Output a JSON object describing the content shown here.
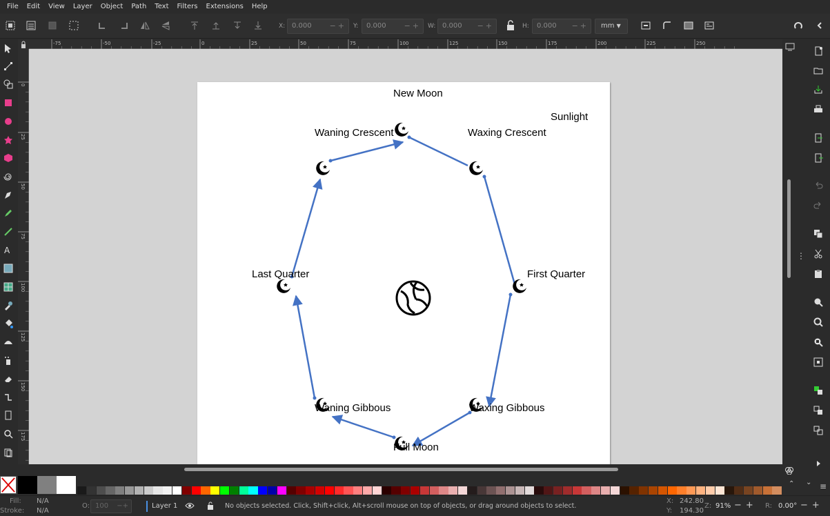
{
  "menu": [
    "File",
    "Edit",
    "View",
    "Layer",
    "Object",
    "Path",
    "Text",
    "Filters",
    "Extensions",
    "Help"
  ],
  "toolbar": {
    "x_label": "X:",
    "x_value": "0.000",
    "y_label": "Y:",
    "y_value": "0.000",
    "w_label": "W:",
    "w_value": "0.000",
    "h_label": "H:",
    "h_value": "0.000",
    "unit": "mm",
    "plus_minus": "−+"
  },
  "hruler_ticks": [
    "-75",
    "-50",
    "-25",
    "0",
    "25",
    "50",
    "75",
    "100",
    "125",
    "150",
    "175",
    "200",
    "225",
    "250"
  ],
  "vruler_ticks": [
    "0",
    "25",
    "50",
    "75",
    "100",
    "125",
    "150",
    "175"
  ],
  "diagram": {
    "center_icon": "earth-icon",
    "phase_icon": "moon-phase-icon",
    "labels": {
      "new_moon": "New Moon",
      "sunlight": "Sunlight",
      "waning_crescent": "Waning Crescent",
      "waxing_crescent": "Waxing Crescent",
      "last_quarter": "Last Quarter",
      "first_quarter": "First Quarter",
      "waning_gibbous": "Waning Gibbous",
      "waxing_gibbous": "Waxing Gibbous",
      "full_moon": "Full Moon"
    },
    "arrow_color": "#4472c4"
  },
  "palette_colors": [
    "#000000",
    "#808080",
    "#ffffff",
    "#1a1a1a",
    "#333333",
    "#4d4d4d",
    "#666666",
    "#808080",
    "#999999",
    "#b3b3b3",
    "#cccccc",
    "#e6e6e6",
    "#f2f2f2",
    "#ffffff",
    "#800000",
    "#ff0000",
    "#ff6600",
    "#ffff00",
    "#00ff00",
    "#008000",
    "#00ff99",
    "#00ffff",
    "#0000ff",
    "#0000aa",
    "#ff00ff",
    "#550000",
    "#800000",
    "#aa0000",
    "#d40000",
    "#ff0000",
    "#ff2a2a",
    "#ff5555",
    "#ff8080",
    "#ffaaaa",
    "#ffd5d5",
    "#2b0000",
    "#550000",
    "#800000",
    "#aa0000",
    "#c83737",
    "#d35f5f",
    "#de8787",
    "#e9afaf",
    "#f4d7d7",
    "#241c1c",
    "#483737",
    "#6c5353",
    "#916f6f",
    "#ac9393",
    "#c8b7b7",
    "#e3dbdb",
    "#280b0b",
    "#501616",
    "#782121",
    "#a02c2c",
    "#c83737",
    "#d35f5f",
    "#de8787",
    "#e9afaf",
    "#f4d7d7",
    "#2b1100",
    "#552200",
    "#803300",
    "#aa4400",
    "#d45500",
    "#ff6600",
    "#ff7f2a",
    "#ff9955",
    "#ffb380",
    "#ffccaa",
    "#ffe6d5",
    "#28170b",
    "#502d16",
    "#784421",
    "#a05a2c",
    "#c87137",
    "#d38d5f",
    "#deaa87",
    "#e9c6af",
    "#f4e3d7",
    "#241f1c",
    "#483e37",
    "#6c5d53"
  ],
  "status": {
    "fill_label": "Fill:",
    "fill_value": "N/A",
    "stroke_label": "Stroke:",
    "stroke_value": "N/A",
    "opacity_label": "O:",
    "opacity_value": "100",
    "layer": "Layer 1",
    "message": "No objects selected. Click, Shift+click, Alt+scroll mouse on top of objects, or drag around objects to select.",
    "x_label": "X:",
    "x_value": "242.80",
    "y_label": "Y:",
    "y_value": "194.30",
    "zoom_label": "Z:",
    "zoom_value": "91%",
    "rotation_label": "R:",
    "rotation_value": "0.00°"
  }
}
